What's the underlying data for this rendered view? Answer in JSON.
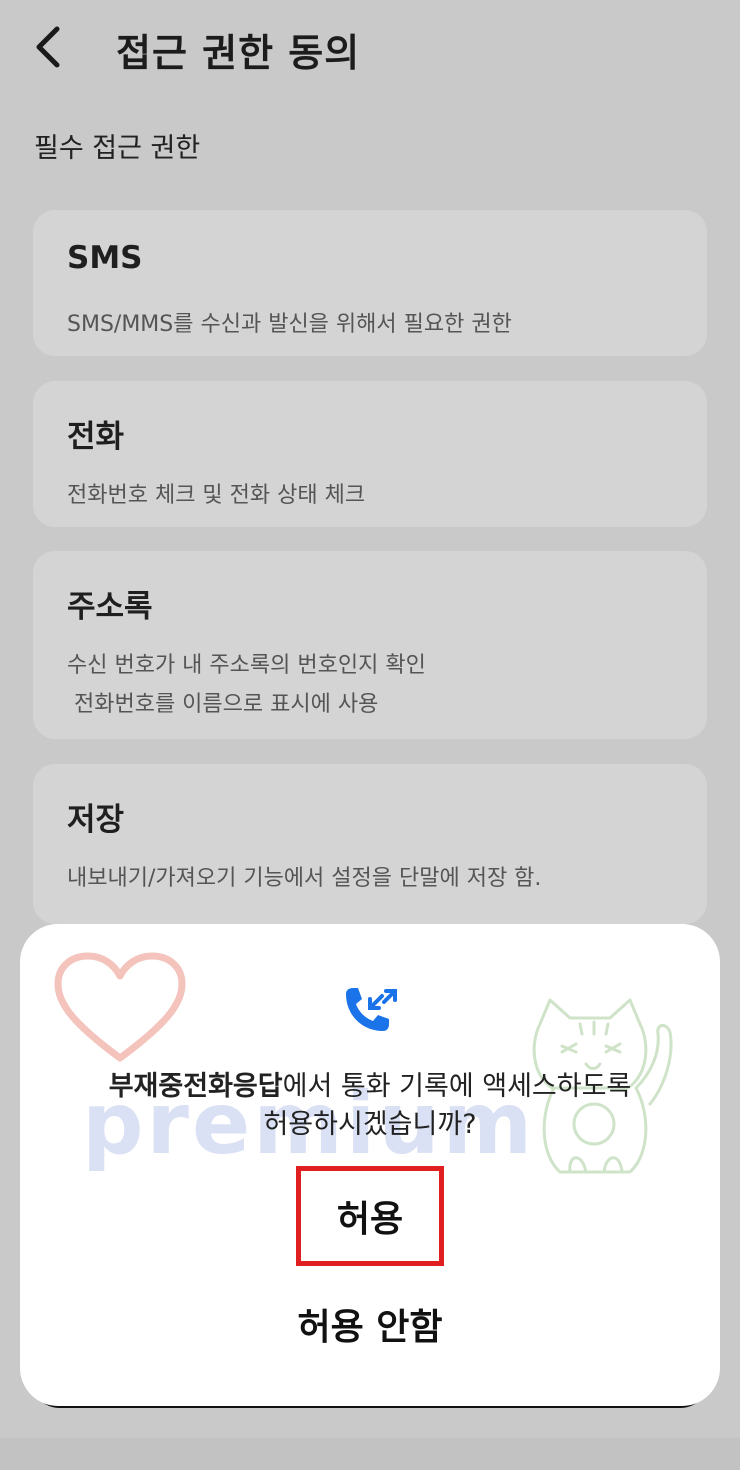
{
  "header": {
    "title": "접근 권한 동의",
    "back_icon": "chevron-left-icon"
  },
  "section": {
    "label": "필수 접근 권한"
  },
  "permissions": [
    {
      "title": "SMS",
      "description": "SMS/MMS를 수신과 발신을 위해서 필요한 권한"
    },
    {
      "title": "전화",
      "description": "전화번호 체크 및 전화 상태 체크"
    },
    {
      "title": "주소록",
      "description": "수신 번호가 내 주소록의 번호인지 확인\n 전화번호를 이름으로 표시에 사용"
    },
    {
      "title": "저장",
      "description": "내보내기/가져오기 기능에서 설정을 단말에 저장 함."
    }
  ],
  "dialog": {
    "icon": "call-log-icon",
    "icon_color": "#1a73e8",
    "app_name": "부재중전화응답",
    "message_rest_line1": "에서 통화 기록에 액세스하도록",
    "message_line2": "허용하시겠습니까?",
    "allow_label": "허용",
    "deny_label": "허용 안함",
    "highlight_color": "#e02020"
  },
  "watermark": {
    "text": "premium"
  }
}
